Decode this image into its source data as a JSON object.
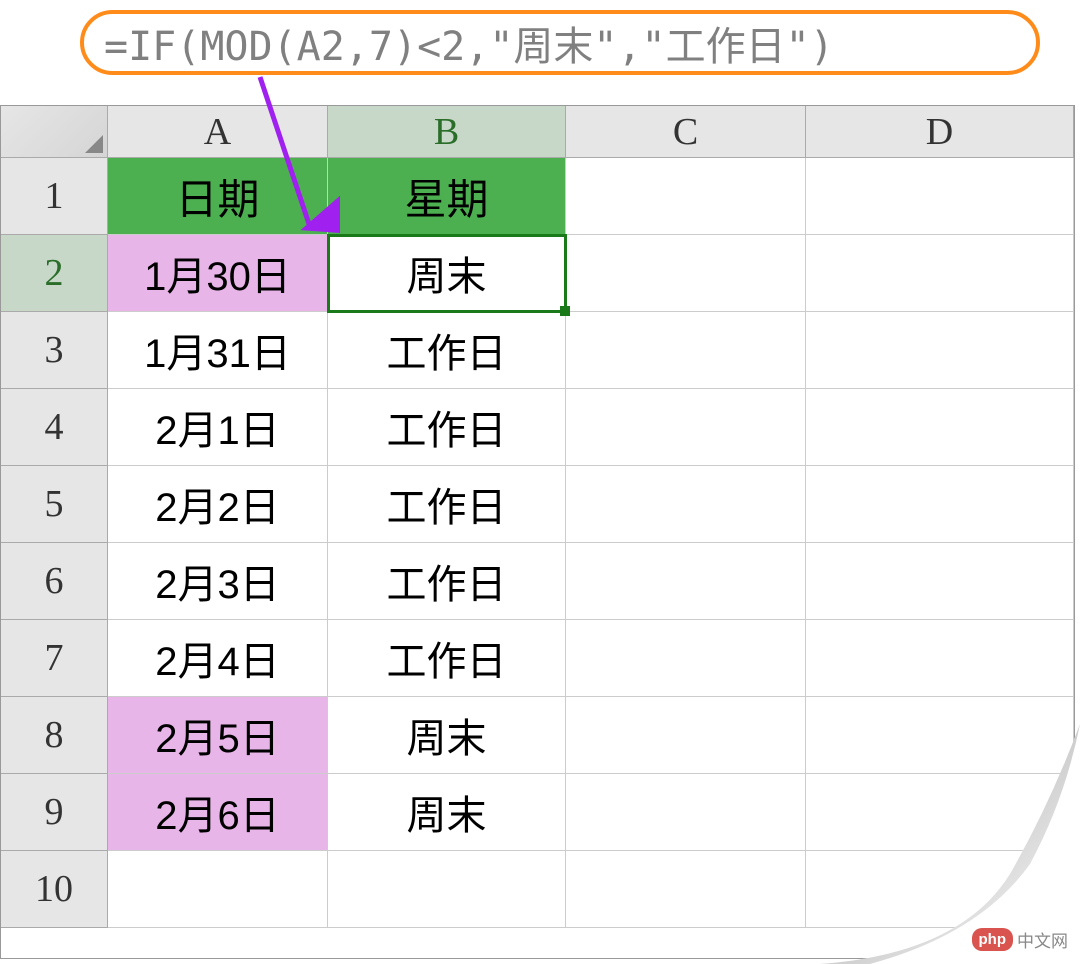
{
  "formula": "=IF(MOD(A2,7)<2,\"周末\",\"工作日\")",
  "columns": [
    "A",
    "B",
    "C",
    "D"
  ],
  "active_column_index": 1,
  "active_row_index": 1,
  "rows": [
    {
      "num": "1",
      "a": "日期",
      "b": "星期",
      "a_class": "header-cell",
      "b_class": "header-cell"
    },
    {
      "num": "2",
      "a": "1月30日",
      "b": "周末",
      "a_class": "pink-cell",
      "b_class": "active-cell"
    },
    {
      "num": "3",
      "a": "1月31日",
      "b": "工作日",
      "a_class": "",
      "b_class": ""
    },
    {
      "num": "4",
      "a": "2月1日",
      "b": "工作日",
      "a_class": "",
      "b_class": ""
    },
    {
      "num": "5",
      "a": "2月2日",
      "b": "工作日",
      "a_class": "",
      "b_class": ""
    },
    {
      "num": "6",
      "a": "2月3日",
      "b": "工作日",
      "a_class": "",
      "b_class": ""
    },
    {
      "num": "7",
      "a": "2月4日",
      "b": "工作日",
      "a_class": "",
      "b_class": ""
    },
    {
      "num": "8",
      "a": "2月5日",
      "b": "周末",
      "a_class": "pink-cell",
      "b_class": ""
    },
    {
      "num": "9",
      "a": "2月6日",
      "b": "周末",
      "a_class": "pink-cell",
      "b_class": ""
    },
    {
      "num": "10",
      "a": "",
      "b": "",
      "a_class": "",
      "b_class": ""
    }
  ],
  "watermark": {
    "badge": "php",
    "text": "中文网"
  }
}
